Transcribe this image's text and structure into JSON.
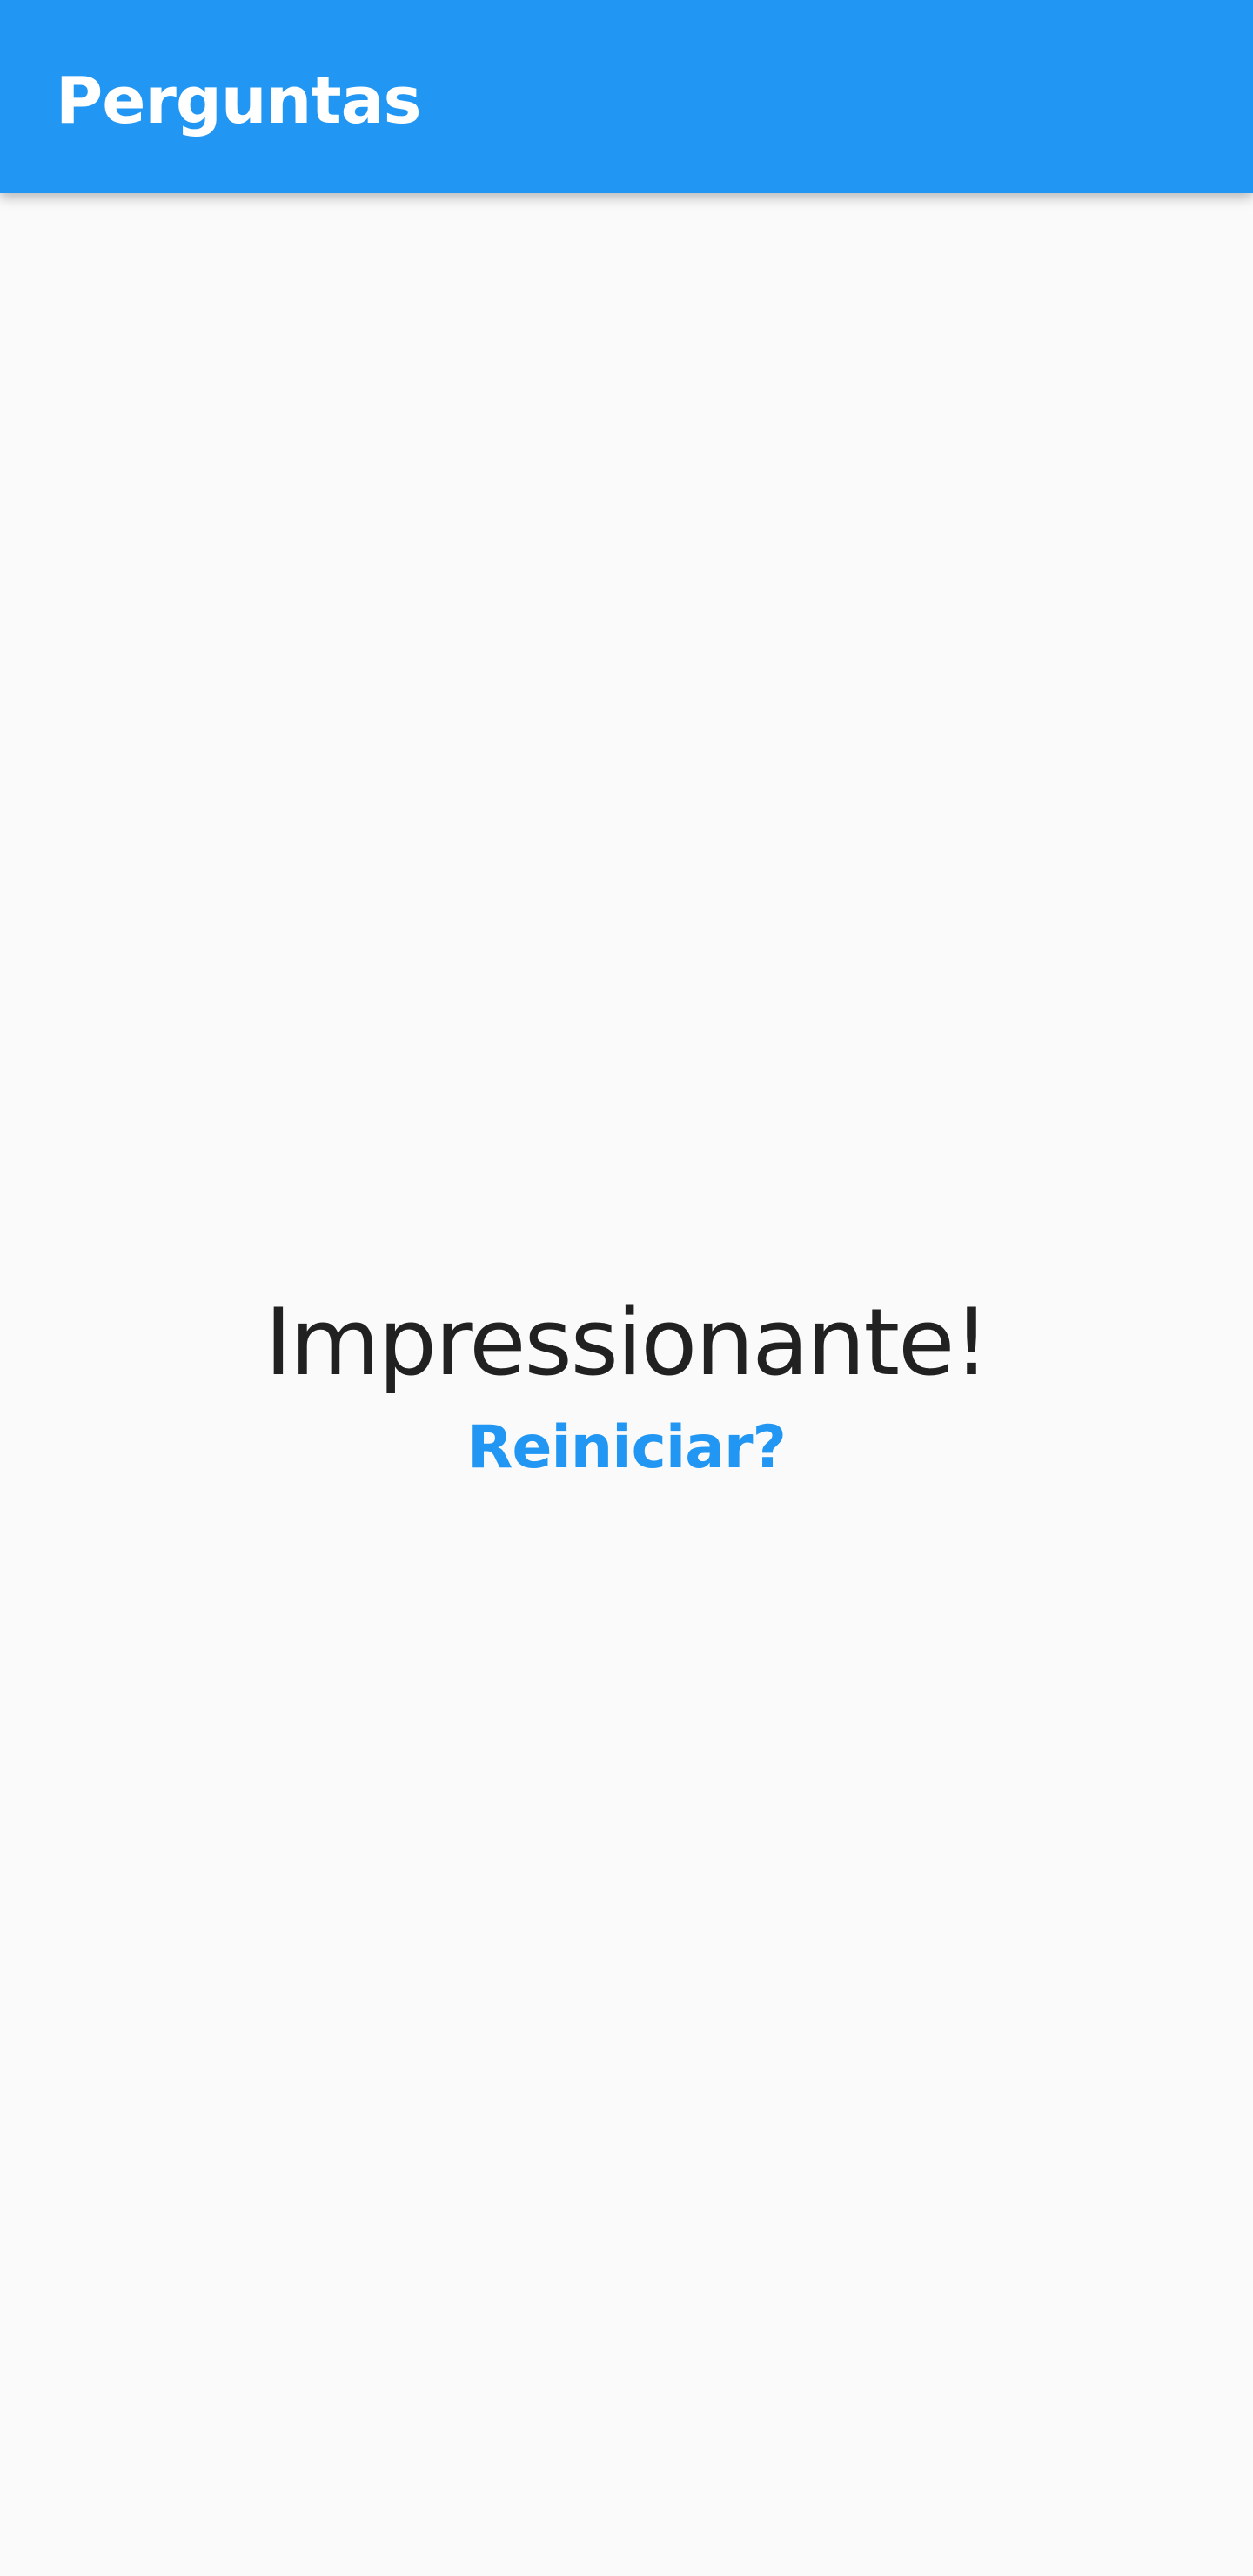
{
  "app_bar": {
    "title": "Perguntas",
    "background_color": "#2196f3",
    "text_color": "#ffffff"
  },
  "result": {
    "message": "Impressionante!",
    "restart_label": "Reiniciar?",
    "message_color": "#212121",
    "restart_color": "#2196f3"
  },
  "page": {
    "background_color": "#fafafa"
  }
}
